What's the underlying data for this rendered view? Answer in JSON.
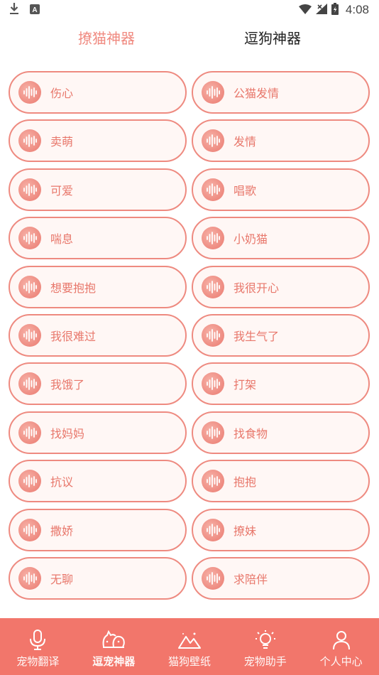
{
  "status_bar": {
    "time": "4:08"
  },
  "top_tabs": [
    {
      "label": "撩猫神器"
    },
    {
      "label": "逗狗神器"
    }
  ],
  "sounds_left": [
    "伤心",
    "卖萌",
    "可爱",
    "喘息",
    "想要抱抱",
    "我很难过",
    "我饿了",
    "找妈妈",
    "抗议",
    "撒娇",
    "无聊"
  ],
  "sounds_right": [
    "公猫发情",
    "发情",
    "唱歌",
    "小奶猫",
    "我很开心",
    "我生气了",
    "打架",
    "找食物",
    "抱抱",
    "撩妹",
    "求陪伴"
  ],
  "bottom_nav": [
    {
      "label": "宠物翻译",
      "icon": "microphone-icon"
    },
    {
      "label": "逗宠神器",
      "icon": "pet-faces-icon"
    },
    {
      "label": "猫狗壁纸",
      "icon": "mountain-image-icon"
    },
    {
      "label": "宠物助手",
      "icon": "lightbulb-icon"
    },
    {
      "label": "个人中心",
      "icon": "person-icon"
    }
  ],
  "colors": {
    "accent": "#f2766b",
    "pill_border": "#ee8a80",
    "pill_bg": "#fff7f5",
    "text_accent": "#e8776b"
  }
}
